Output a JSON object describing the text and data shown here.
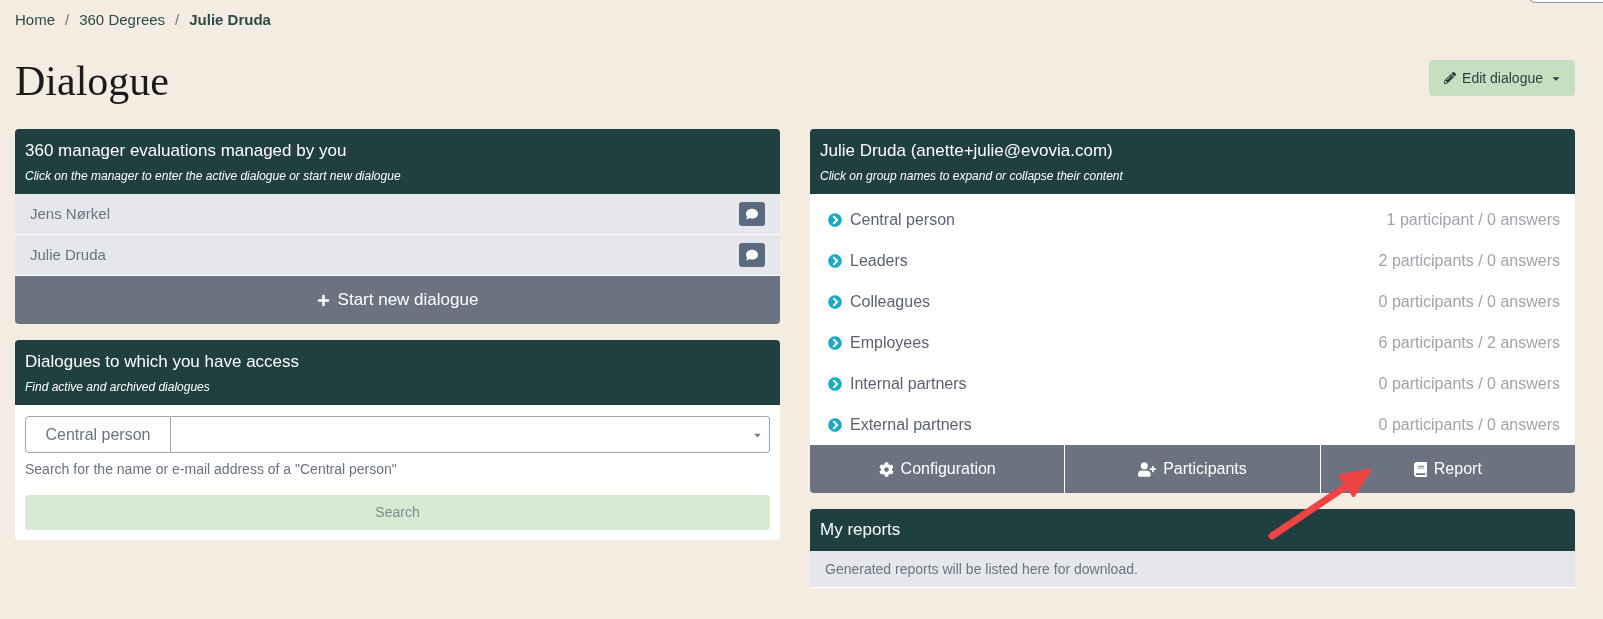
{
  "breadcrumb": [
    {
      "label": "Home",
      "current": false,
      "separator": "/"
    },
    {
      "label": "360 Degrees",
      "current": false,
      "separator": "/"
    },
    {
      "label": "Julie Druda",
      "current": true
    }
  ],
  "page_title": "Dialogue",
  "edit_button": {
    "label": "Edit dialogue"
  },
  "managed_panel": {
    "title": "360 manager evaluations managed by you",
    "subtitle": "Click on the manager to enter the active dialogue or start new dialogue",
    "managers": [
      {
        "name": "Jens Nørkel"
      },
      {
        "name": "Julie Druda"
      }
    ],
    "start_button": "Start new dialogue"
  },
  "access_panel": {
    "title": "Dialogues to which you have access",
    "subtitle": "Find active and archived dialogues",
    "search_field": {
      "addon": "Central person"
    },
    "help_text": "Search for the name or e-mail address of a \"Central person\"",
    "search_button": {
      "label": "Search",
      "disabled": true
    }
  },
  "dialogue_panel": {
    "title": "Julie Druda (anette+julie@evovia.com)",
    "subtitle": "Click on group names to expand or collapse their content",
    "groups": [
      {
        "name": "Central person",
        "summary": "1 participant / 0 answers",
        "expanded": false
      },
      {
        "name": "Leaders",
        "summary": "2 participants / 0 answers",
        "expanded": false
      },
      {
        "name": "Colleagues",
        "summary": "0 participants / 0 answers",
        "expanded": false
      },
      {
        "name": "Employees",
        "summary": "6 participants / 2 answers",
        "expanded": false
      },
      {
        "name": "Internal partners",
        "summary": "0 participants / 0 answers",
        "expanded": false
      },
      {
        "name": "External partners",
        "summary": "0 participants / 0 answers",
        "expanded": false
      }
    ],
    "actions": [
      {
        "kind": "settings",
        "label": "Configuration"
      },
      {
        "kind": "people",
        "label": "Participants"
      },
      {
        "kind": "report",
        "label": "Report"
      }
    ]
  },
  "reports_panel": {
    "title": "My reports",
    "empty_text": "Generated reports will be listed here for download."
  }
}
